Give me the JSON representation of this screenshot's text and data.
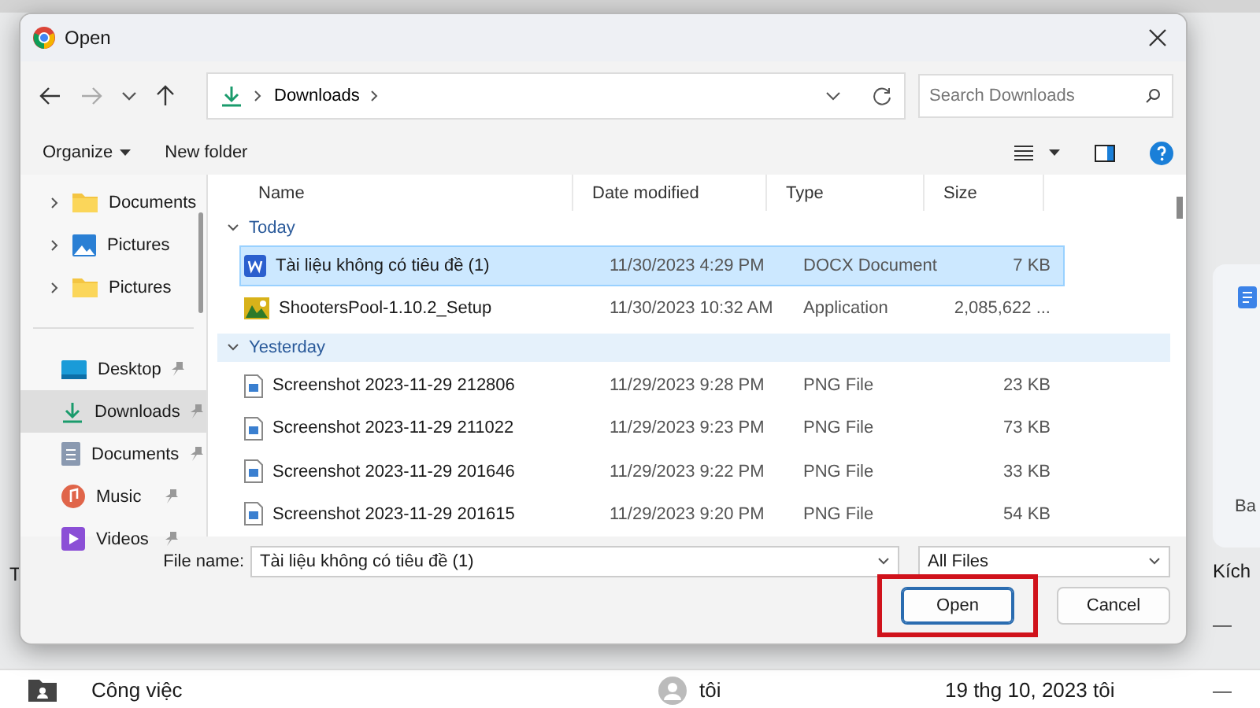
{
  "background": {
    "column_letter": "T",
    "column_header": "Kích",
    "card_text": "Ba",
    "rows": [
      {
        "size": "—"
      },
      {
        "name": "Công việc",
        "owner": "tôi",
        "modified": "19 thg 10, 2023 tôi",
        "size": "—"
      }
    ]
  },
  "window": {
    "title": "Open"
  },
  "nav": {
    "path": [
      "Downloads"
    ],
    "search": {
      "placeholder": "Search Downloads"
    }
  },
  "toolbar": {
    "organize": "Organize",
    "new_folder": "New folder"
  },
  "sidebar": {
    "tree": [
      {
        "label": "Documents",
        "kind": "folder",
        "expanded": false
      },
      {
        "label": "Pictures",
        "kind": "pictures",
        "expanded": false
      },
      {
        "label": "Pictures",
        "kind": "folder",
        "expanded": false
      }
    ],
    "quick_access": [
      {
        "label": "Desktop",
        "kind": "desktop",
        "pinned": true,
        "selected": false
      },
      {
        "label": "Downloads",
        "kind": "downloads",
        "pinned": true,
        "selected": true
      },
      {
        "label": "Documents",
        "kind": "documents",
        "pinned": true,
        "selected": false
      },
      {
        "label": "Music",
        "kind": "music",
        "pinned": true,
        "selected": false
      },
      {
        "label": "Videos",
        "kind": "videos",
        "pinned": true,
        "selected": false
      }
    ]
  },
  "table": {
    "columns": [
      "Name",
      "Date modified",
      "Type",
      "Size"
    ],
    "groups": [
      {
        "label": "Today",
        "expanded": true,
        "hovered": false,
        "files": [
          {
            "name": "Tài liệu không có tiêu đề (1)",
            "date": "11/30/2023 4:29 PM",
            "type": "DOCX Document",
            "size": "7 KB",
            "kind": "word",
            "selected": true
          },
          {
            "name": "ShootersPool-1.10.2_Setup",
            "date": "11/30/2023 10:32 AM",
            "type": "Application",
            "size": "2,085,622 ...",
            "kind": "app",
            "selected": false
          }
        ]
      },
      {
        "label": "Yesterday",
        "expanded": true,
        "hovered": true,
        "files": [
          {
            "name": "Screenshot 2023-11-29 212806",
            "date": "11/29/2023 9:28 PM",
            "type": "PNG File",
            "size": "23 KB",
            "kind": "image",
            "selected": false
          },
          {
            "name": "Screenshot 2023-11-29 211022",
            "date": "11/29/2023 9:23 PM",
            "type": "PNG File",
            "size": "73 KB",
            "kind": "image",
            "selected": false
          },
          {
            "name": "Screenshot 2023-11-29 201646",
            "date": "11/29/2023 9:22 PM",
            "type": "PNG File",
            "size": "33 KB",
            "kind": "image",
            "selected": false
          },
          {
            "name": "Screenshot 2023-11-29 201615",
            "date": "11/29/2023 9:20 PM",
            "type": "PNG File",
            "size": "54 KB",
            "kind": "image",
            "selected": false
          }
        ]
      }
    ]
  },
  "footer": {
    "file_name_label": "File name:",
    "file_name": "Tài liệu không có tiêu đề (1)",
    "filter": "All Files",
    "buttons": [
      {
        "label": "Open",
        "default": true,
        "annotated": true
      },
      {
        "label": "Cancel",
        "default": false,
        "annotated": false
      }
    ]
  }
}
